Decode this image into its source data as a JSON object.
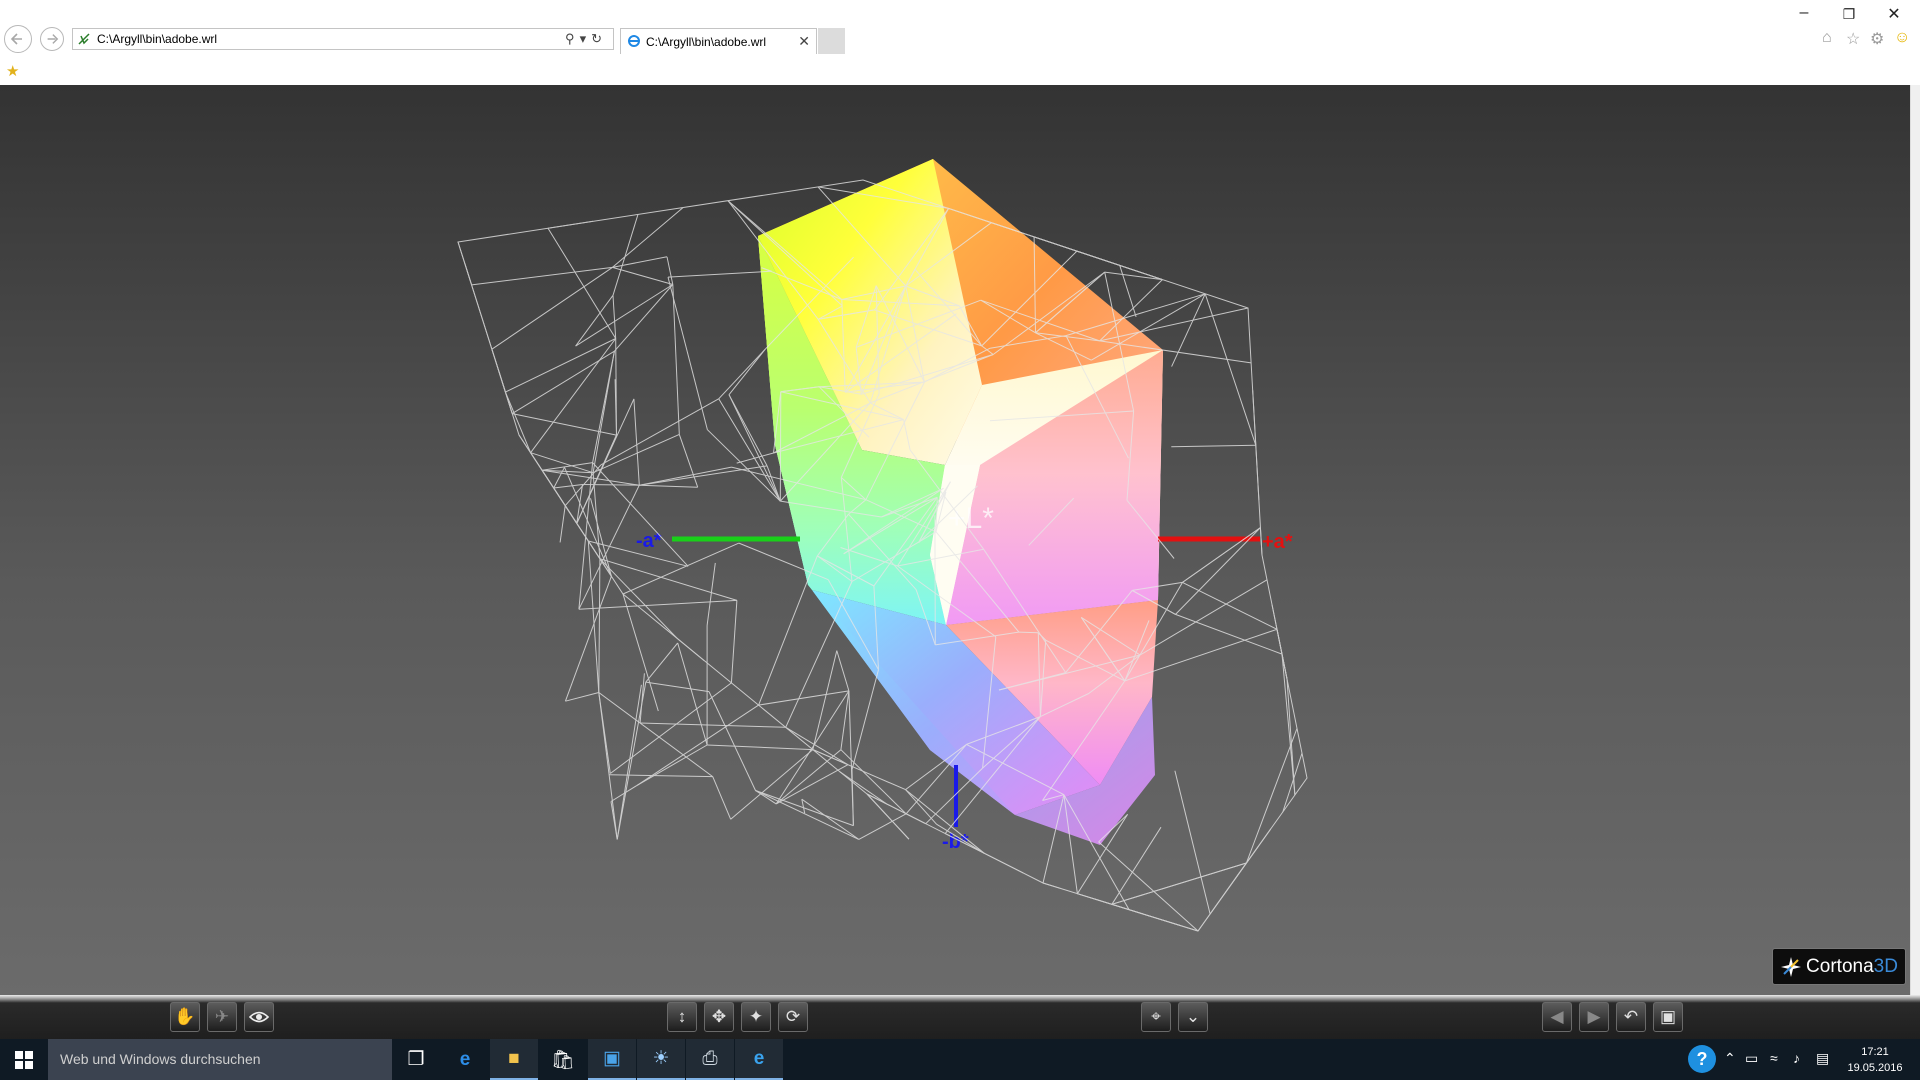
{
  "browser": {
    "address_url": "C:\\Argyll\\bin\\adobe.wrl",
    "tab_title": "C:\\Argyll\\bin\\adobe.wrl",
    "address_tools": [
      "search-icon",
      "dropdown-icon",
      "refresh-icon"
    ],
    "window_buttons": [
      "minimize",
      "restore",
      "close"
    ],
    "right_tools": [
      "home-icon",
      "favorites-star-icon",
      "settings-gear-icon",
      "smiley-feedback-icon"
    ]
  },
  "viewer": {
    "axis_labels": {
      "plus_l": "+L*",
      "plus_a": "+a*",
      "minus_a": "-a*",
      "minus_b": "-b*"
    },
    "axis_colors": {
      "a_pos": "#e41010",
      "a_neg": "#19d019",
      "b_neg": "#1a1ae8",
      "l": "#ffffff"
    },
    "brand": {
      "part1": "Cortona",
      "part2": "3D"
    },
    "toolbar_groups": {
      "left": [
        "hand-icon",
        "plane-icon",
        "eye-icon"
      ],
      "center": [
        "move-updown-icon",
        "pan-icon",
        "fly-icon",
        "rotate-icon"
      ],
      "mid": [
        "target-icon",
        "floor-align-icon"
      ],
      "right": [
        "prev-viewpoint-icon",
        "next-viewpoint-icon",
        "restore-view-icon",
        "fit-view-icon"
      ]
    }
  },
  "taskbar": {
    "search_placeholder": "Web und Windows durchsuchen",
    "time": "17:21",
    "date": "19.05.2016",
    "apps": [
      "task-view",
      "edge",
      "file-explorer",
      "store",
      "control-panel",
      "paint",
      "printer-app",
      "internet-explorer"
    ]
  }
}
